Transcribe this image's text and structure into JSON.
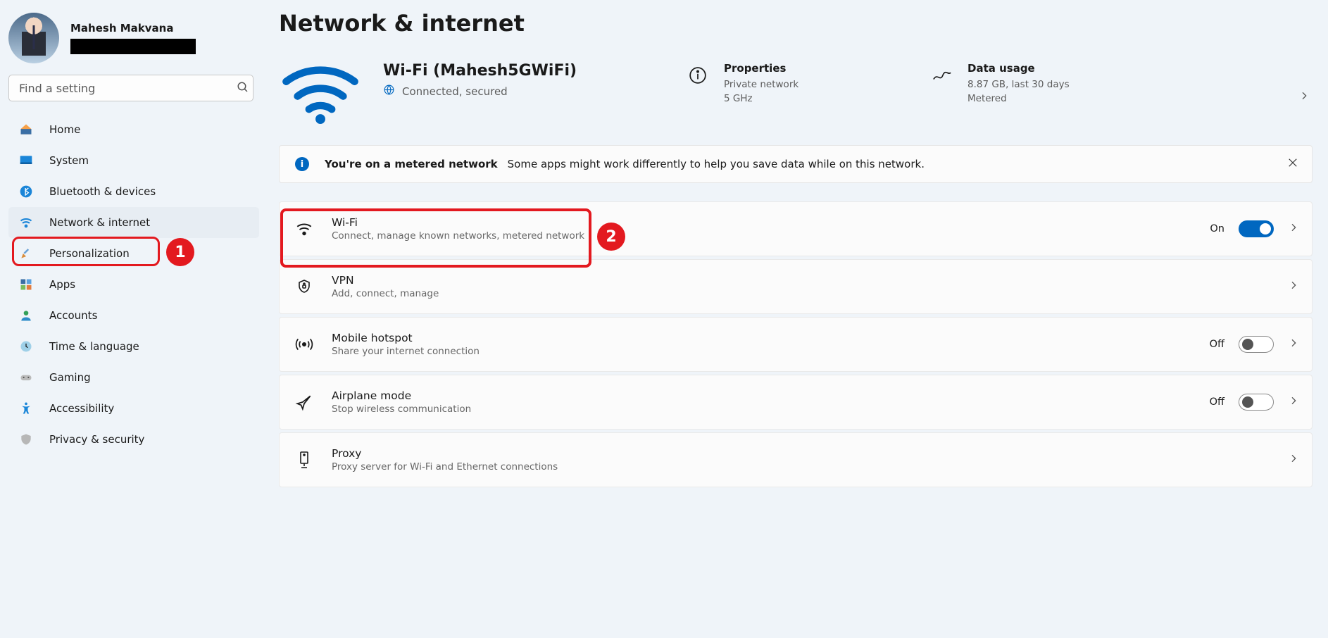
{
  "profile": {
    "name": "Mahesh Makvana"
  },
  "search": {
    "placeholder": "Find a setting"
  },
  "nav": [
    {
      "label": "Home"
    },
    {
      "label": "System"
    },
    {
      "label": "Bluetooth & devices"
    },
    {
      "label": "Network & internet"
    },
    {
      "label": "Personalization"
    },
    {
      "label": "Apps"
    },
    {
      "label": "Accounts"
    },
    {
      "label": "Time & language"
    },
    {
      "label": "Gaming"
    },
    {
      "label": "Accessibility"
    },
    {
      "label": "Privacy & security"
    }
  ],
  "page_title": "Network & internet",
  "connection": {
    "ssid": "Wi-Fi (Mahesh5GWiFi)",
    "state": "Connected, secured"
  },
  "properties": {
    "title": "Properties",
    "line1": "Private network",
    "line2": "5 GHz"
  },
  "usage": {
    "title": "Data usage",
    "line1": "8.87 GB, last 30 days",
    "line2": "Metered"
  },
  "notice": {
    "head": "You're on a metered network",
    "body": "Some apps might work differently to help you save data while on this network."
  },
  "cards": {
    "wifi": {
      "title": "Wi-Fi",
      "sub": "Connect, manage known networks, metered network",
      "state": "On"
    },
    "vpn": {
      "title": "VPN",
      "sub": "Add, connect, manage"
    },
    "hotspot": {
      "title": "Mobile hotspot",
      "sub": "Share your internet connection",
      "state": "Off"
    },
    "airplane": {
      "title": "Airplane mode",
      "sub": "Stop wireless communication",
      "state": "Off"
    },
    "proxy": {
      "title": "Proxy",
      "sub": "Proxy server for Wi-Fi and Ethernet connections"
    }
  },
  "annotations": {
    "marker1": "1",
    "marker2": "2"
  }
}
